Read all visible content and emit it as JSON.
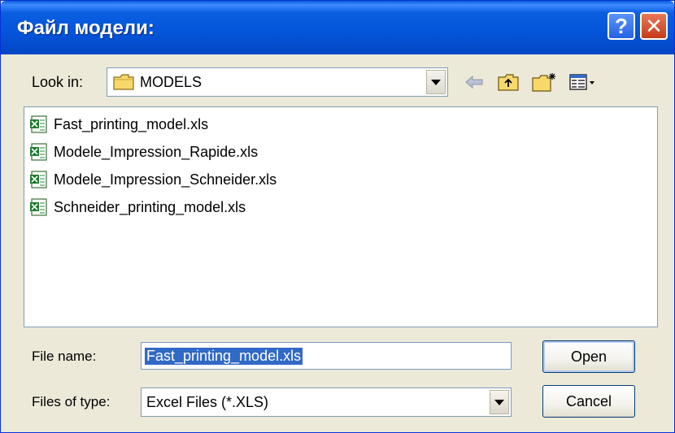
{
  "window": {
    "title": "Файл модели:",
    "help_label": "?",
    "close_label": "✕"
  },
  "lookin": {
    "label": "Look in:",
    "value": "MODELS"
  },
  "files": [
    {
      "name": "Fast_printing_model.xls"
    },
    {
      "name": "Modele_Impression_Rapide.xls"
    },
    {
      "name": "Modele_Impression_Schneider.xls"
    },
    {
      "name": "Schneider_printing_model.xls"
    }
  ],
  "filename": {
    "label": "File name:",
    "value": "Fast_printing_model.xls"
  },
  "filetype": {
    "label": "Files of type:",
    "value": "Excel Files (*.XLS)"
  },
  "buttons": {
    "open": "Open",
    "cancel": "Cancel"
  },
  "icons": {
    "back": "back-arrow-icon",
    "up": "up-folder-icon",
    "new_folder": "new-folder-icon",
    "view": "view-menu-icon"
  },
  "colors": {
    "titlebar": "#0454d9",
    "selection": "#3169c6",
    "dialog_bg": "#ece9d8"
  }
}
